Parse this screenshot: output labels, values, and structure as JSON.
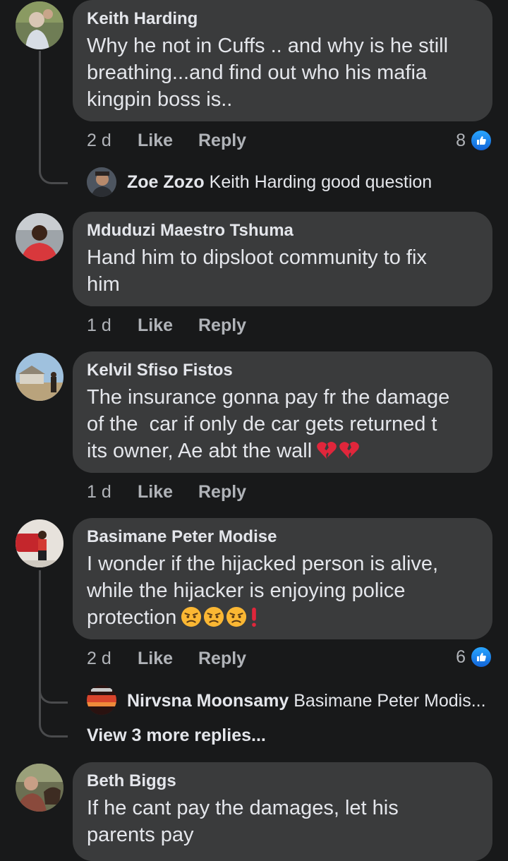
{
  "comments": [
    {
      "author": "Keith Harding",
      "text": "Why he not in Cuffs .. and why is he still\nbreathing...and find out who his mafia\nkingpin boss is..",
      "time": "2 d",
      "like": "Like",
      "reply": "Reply",
      "reactions": "8",
      "replies": [
        {
          "author": "Zoe Zozo",
          "text": "Keith Harding good question"
        }
      ]
    },
    {
      "author": "Mduduzi Maestro Tshuma",
      "text": "Hand him to dipsloot community to fix\nhim",
      "time": "1 d",
      "like": "Like",
      "reply": "Reply"
    },
    {
      "author": "Kelvil Sfiso Fistos",
      "text": "The insurance gonna pay fr the damage\nof the  car if only de car gets returned t\nits owner, Ae abt the wall",
      "time": "1 d",
      "like": "Like",
      "reply": "Reply"
    },
    {
      "author": "Basimane Peter Modise",
      "text": "I wonder if the hijacked person is alive,\nwhile the hijacker is enjoying police\nprotection",
      "time": "2 d",
      "like": "Like",
      "reply": "Reply",
      "reactions": "6",
      "replies": [
        {
          "author": "Nirvsna Moonsamy",
          "text": "Basimane Peter Modis..."
        }
      ],
      "more_replies": "View 3 more replies..."
    },
    {
      "author": "Beth Biggs",
      "text": "If he cant pay the damages, let his\nparents pay"
    }
  ],
  "icons": {
    "reaction": "like-icon",
    "broken_heart": "broken-heart-icon",
    "angry_face": "angry-face-icon",
    "exclamation": "red-exclamation-icon"
  },
  "colors": {
    "background": "#18191a",
    "bubble": "#3a3b3c",
    "like_blue": "#1877f2"
  }
}
